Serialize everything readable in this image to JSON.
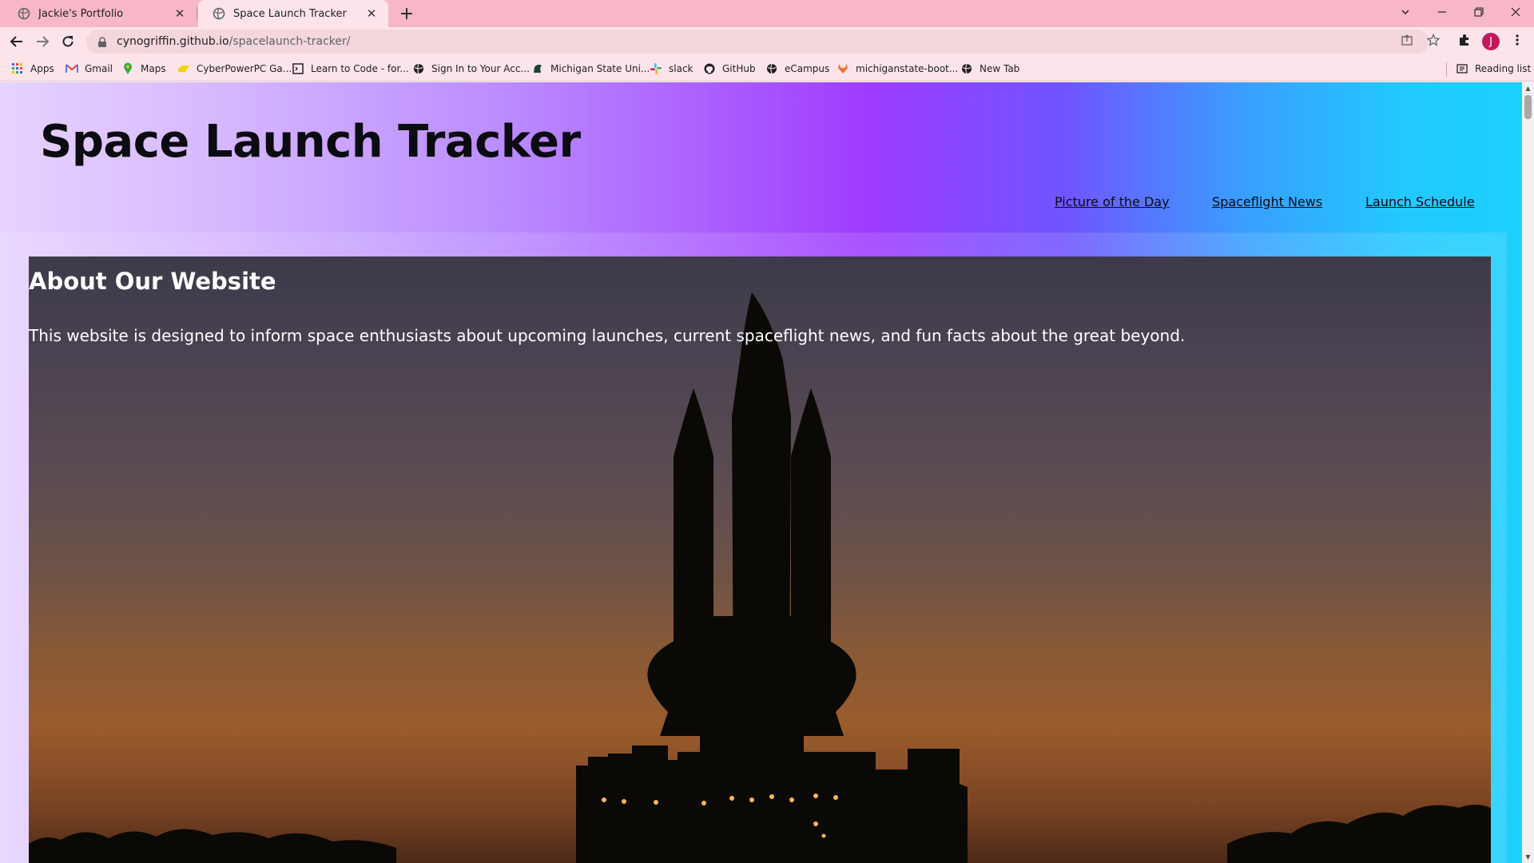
{
  "browser": {
    "tabs": [
      {
        "title": "Jackie's Portfolio",
        "active": false
      },
      {
        "title": "Space Launch Tracker",
        "active": true
      }
    ],
    "new_tab_symbol": "+",
    "close_symbol": "✕",
    "window_controls": {
      "minimize": "—",
      "restore": "❐",
      "close": "✕",
      "tab_search": "⌄"
    },
    "url_host": "cynogriffin.github.io",
    "url_path": "/spacelaunch-tracker/",
    "profile_initial": "J",
    "bookmarks": [
      {
        "label": "Apps",
        "icon": "apps-grid-icon"
      },
      {
        "label": "Gmail",
        "icon": "gmail-icon"
      },
      {
        "label": "Maps",
        "icon": "maps-pin-icon"
      },
      {
        "label": "CyberPowerPC Ga...",
        "icon": "cyberpower-icon"
      },
      {
        "label": "Learn to Code - for...",
        "icon": "learn-code-icon"
      },
      {
        "label": "Sign In to Your Acc...",
        "icon": "globe-icon"
      },
      {
        "label": "Michigan State Uni...",
        "icon": "spartan-icon"
      },
      {
        "label": "slack",
        "icon": "slack-icon"
      },
      {
        "label": "GitHub",
        "icon": "github-icon"
      },
      {
        "label": "eCampus",
        "icon": "globe-icon"
      },
      {
        "label": "michiganstate-boot...",
        "icon": "gitlab-icon"
      },
      {
        "label": "New Tab",
        "icon": "globe-icon"
      }
    ],
    "reading_list": "Reading list"
  },
  "page": {
    "site_title": "Space Launch Tracker",
    "nav": [
      {
        "label": "Picture of the Day"
      },
      {
        "label": "Spaceflight News"
      },
      {
        "label": "Launch Schedule"
      }
    ],
    "about": {
      "heading": "About Our Website",
      "text": "This website is designed to inform space enthusiasts about upcoming launches, current spaceflight news, and fun facts about the great beyond."
    }
  },
  "colors": {
    "tab_strip": "#f7b7c6",
    "toolbar": "#fde4ea",
    "gradient_start": "#e6d3ff",
    "gradient_mid": "#9f3cff",
    "gradient_end": "#1cd0ff",
    "avatar": "#c2185b"
  }
}
